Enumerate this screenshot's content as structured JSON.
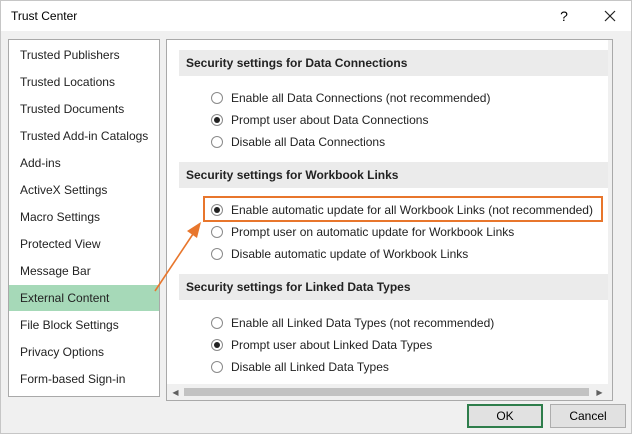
{
  "window": {
    "title": "Trust Center",
    "help_label": "?"
  },
  "sidebar": {
    "items": [
      {
        "label": "Trusted Publishers"
      },
      {
        "label": "Trusted Locations"
      },
      {
        "label": "Trusted Documents"
      },
      {
        "label": "Trusted Add-in Catalogs"
      },
      {
        "label": "Add-ins"
      },
      {
        "label": "ActiveX Settings"
      },
      {
        "label": "Macro Settings"
      },
      {
        "label": "Protected View"
      },
      {
        "label": "Message Bar"
      },
      {
        "label": "External Content"
      },
      {
        "label": "File Block Settings"
      },
      {
        "label": "Privacy Options"
      },
      {
        "label": "Form-based Sign-in"
      }
    ],
    "selected_label": "External Content"
  },
  "sections": [
    {
      "title": "Security settings for Data Connections",
      "options": [
        {
          "label": "Enable all Data Connections (not recommended)",
          "checked": false
        },
        {
          "label": "Prompt user about Data Connections",
          "checked": true
        },
        {
          "label": "Disable all Data Connections",
          "checked": false
        }
      ]
    },
    {
      "title": "Security settings for Workbook Links",
      "options": [
        {
          "label": "Enable automatic update for all Workbook Links (not recommended)",
          "checked": true
        },
        {
          "label": "Prompt user on automatic update for Workbook Links",
          "checked": false
        },
        {
          "label": "Disable automatic update of Workbook Links",
          "checked": false
        }
      ]
    },
    {
      "title": "Security settings for Linked Data Types",
      "options": [
        {
          "label": "Enable all Linked Data Types (not recommended)",
          "checked": false
        },
        {
          "label": "Prompt user about Linked Data Types",
          "checked": true
        },
        {
          "label": "Disable all Linked Data Types",
          "checked": false
        }
      ]
    }
  ],
  "buttons": {
    "ok_label": "OK",
    "cancel_label": "Cancel"
  },
  "colors": {
    "selected_nav_bg": "#a6d9b8",
    "annotation_orange": "#e8762c",
    "ok_border": "#2e7d4b"
  }
}
